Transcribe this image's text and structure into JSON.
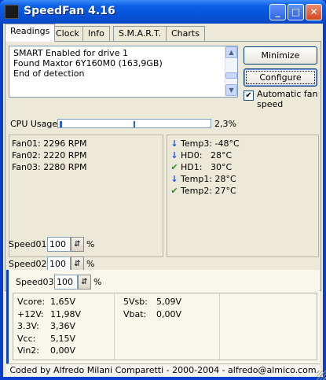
{
  "window": {
    "title": "SpeedFan 4.16"
  },
  "title_buttons": {
    "minimize": "_",
    "maximize": "□",
    "close": "✕"
  },
  "tabs": [
    {
      "label": "Readings",
      "active": true
    },
    {
      "label": "Clock",
      "active": false
    },
    {
      "label": "Info",
      "active": false
    },
    {
      "label": "S.M.A.R.T.",
      "active": false
    },
    {
      "label": "Charts",
      "active": false
    }
  ],
  "log": {
    "lines": [
      "SMART Enabled for drive 1",
      "Found Maxtor 6Y160M0 (163,9GB)",
      "End of detection"
    ]
  },
  "buttons": {
    "minimize": "Minimize",
    "configure": "Configure"
  },
  "auto_fan": {
    "label": "Automatic fan speed",
    "checked": true
  },
  "cpu": {
    "label": "CPU Usage",
    "value": "2,3%",
    "fraction": 0.023
  },
  "fans": [
    {
      "name": "Fan01:",
      "value": "2296 RPM"
    },
    {
      "name": "Fan02:",
      "value": "2220 RPM"
    },
    {
      "name": "Fan03:",
      "value": "2280 RPM"
    }
  ],
  "temps": [
    {
      "name": "Temp3:",
      "value": "-48°C",
      "status": "down-arrow"
    },
    {
      "name": "HD0:",
      "value": "28°C",
      "status": "down-arrow"
    },
    {
      "name": "HD1:",
      "value": "30°C",
      "status": "check"
    },
    {
      "name": "Temp1:",
      "value": "28°C",
      "status": "down-arrow"
    },
    {
      "name": "Temp2:",
      "value": "27°C",
      "status": "check"
    }
  ],
  "speeds": [
    {
      "label": "Speed01:",
      "value": "100",
      "unit": "%"
    },
    {
      "label": "Speed02:",
      "value": "100",
      "unit": "%"
    },
    {
      "label": "Speed03:",
      "value": "100",
      "unit": "%"
    }
  ],
  "voltages_left": [
    {
      "name": "Vcore:",
      "value": "1,65V"
    },
    {
      "name": "+12V:",
      "value": "11,98V"
    },
    {
      "name": "3.3V:",
      "value": "3,36V"
    },
    {
      "name": "Vcc:",
      "value": "5,15V"
    },
    {
      "name": "Vin2:",
      "value": "0,00V"
    }
  ],
  "voltages_right": [
    {
      "name": "5Vsb:",
      "value": "5,09V"
    },
    {
      "name": "Vbat:",
      "value": "0,00V"
    }
  ],
  "footer": {
    "text": "Coded by Alfredo Milani Comparetti - 2000-2004 - alfredo@almico.com"
  },
  "colors": {
    "titlebar": "#0754dc",
    "face": "#ece9d8",
    "arrow": "#2451d8",
    "check": "#2a8a2a"
  }
}
